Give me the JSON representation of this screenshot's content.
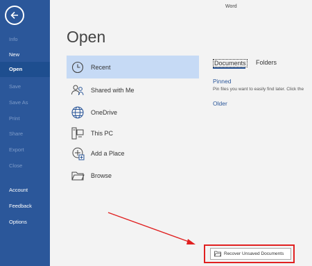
{
  "window": {
    "title": "Word"
  },
  "sidebar": {
    "items": [
      {
        "label": "Info",
        "enabled": false
      },
      {
        "label": "New",
        "enabled": true
      },
      {
        "label": "Open",
        "enabled": true,
        "selected": true
      },
      {
        "label": "Save",
        "enabled": false
      },
      {
        "label": "Save As",
        "enabled": false
      },
      {
        "label": "Print",
        "enabled": false
      },
      {
        "label": "Share",
        "enabled": false
      },
      {
        "label": "Export",
        "enabled": false
      },
      {
        "label": "Close",
        "enabled": false
      },
      {
        "label": "Account",
        "enabled": true
      },
      {
        "label": "Feedback",
        "enabled": true
      },
      {
        "label": "Options",
        "enabled": true
      }
    ]
  },
  "page": {
    "title": "Open"
  },
  "locations": [
    {
      "label": "Recent",
      "icon": "clock-icon",
      "selected": true
    },
    {
      "label": "Shared with Me",
      "icon": "people-icon"
    },
    {
      "label": "OneDrive",
      "icon": "globe-icon"
    },
    {
      "label": "This PC",
      "icon": "computer-icon"
    },
    {
      "label": "Add a Place",
      "icon": "add-place-icon"
    },
    {
      "label": "Browse",
      "icon": "folder-icon"
    }
  ],
  "tabs": {
    "documents": "Documents",
    "folders": "Folders"
  },
  "pinned": {
    "heading": "Pinned",
    "description": "Pin files you want to easily find later. Click the"
  },
  "older": {
    "heading": "Older"
  },
  "recover_button": {
    "label": "Recover Unsaved Documents",
    "icon": "folder-icon"
  },
  "colors": {
    "accent": "#2b579a",
    "highlight": "#e02020",
    "selected_bg": "#c6daf5"
  }
}
